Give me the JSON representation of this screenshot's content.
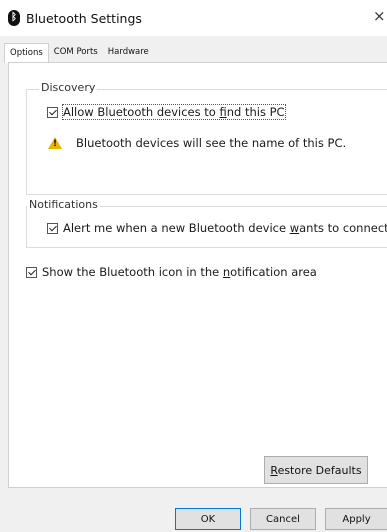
{
  "window": {
    "title": "Bluetooth Settings",
    "close_glyph": "×"
  },
  "tabs": [
    {
      "label": "Options",
      "active": true
    },
    {
      "label": "COM Ports",
      "active": false
    },
    {
      "label": "Hardware",
      "active": false
    }
  ],
  "discovery": {
    "group_label": "Discovery",
    "allow_pre": "Allow Bluetooth devices to ",
    "allow_ul": "f",
    "allow_post": "ind this PC",
    "allow_checked": true,
    "warning_text": "Bluetooth devices will see the name of this PC."
  },
  "notifications": {
    "group_label": "Notifications",
    "alert_pre": "Alert me when a new Bluetooth device ",
    "alert_ul": "w",
    "alert_post": "ants to connect",
    "alert_checked": true
  },
  "show_icon": {
    "pre": "Show the Bluetooth icon in the ",
    "ul": "n",
    "post": "otification area",
    "checked": true
  },
  "buttons": {
    "restore_ul": "R",
    "restore_rest": "estore Defaults",
    "ok": "OK",
    "cancel": "Cancel",
    "apply": "Apply"
  },
  "icons": {
    "bluetooth": "bluetooth-icon",
    "warning": "warning-icon",
    "close": "close-icon"
  },
  "colors": {
    "default_button_border": "#0078d7",
    "warning": "#e8b400"
  }
}
